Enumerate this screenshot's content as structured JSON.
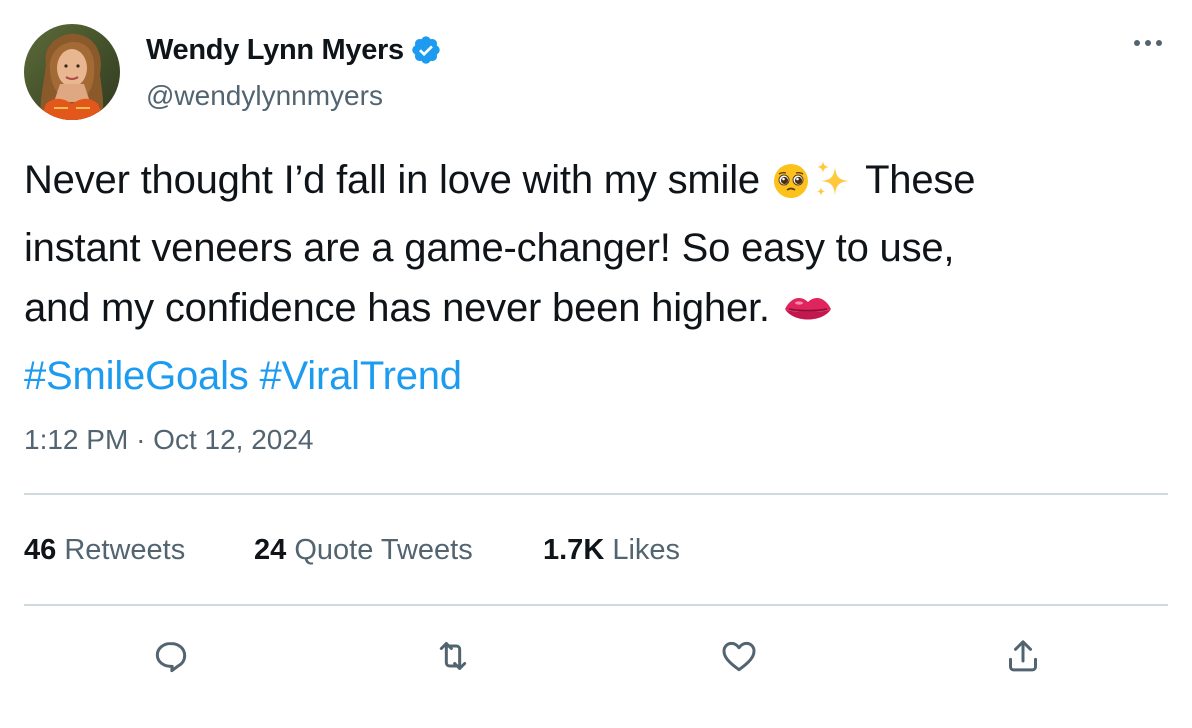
{
  "author": {
    "display_name": "Wendy Lynn Myers",
    "handle": "@wendylynnmyers",
    "verified": true,
    "avatar_icon": "profile-photo"
  },
  "tweet": {
    "text_line1": "Never thought I’d fall in love with my smile",
    "text_line1_end": "These",
    "text_line2": "instant veneers are a game-changer! So easy to use,",
    "text_line3": "and my confidence has never been higher.",
    "emojis": [
      "pleading-face",
      "sparkles",
      "kiss-mark"
    ],
    "hashtags": [
      "#SmileGoals",
      "#ViralTrend"
    ],
    "time": "1:12 PM",
    "separator": "·",
    "date": "Oct 12, 2024"
  },
  "stats": {
    "retweets_count": "46",
    "retweets_label": "Retweets",
    "quotes_count": "24",
    "quotes_label": "Quote Tweets",
    "likes_count": "1.7K",
    "likes_label": "Likes"
  },
  "actions": {
    "icons": [
      "reply-icon",
      "retweet-icon",
      "like-icon",
      "share-icon"
    ]
  },
  "colors": {
    "link": "#1d9bf0",
    "secondary_text": "#536471",
    "divider": "#cfd9de",
    "verified_badge": "#1d9bf0"
  }
}
